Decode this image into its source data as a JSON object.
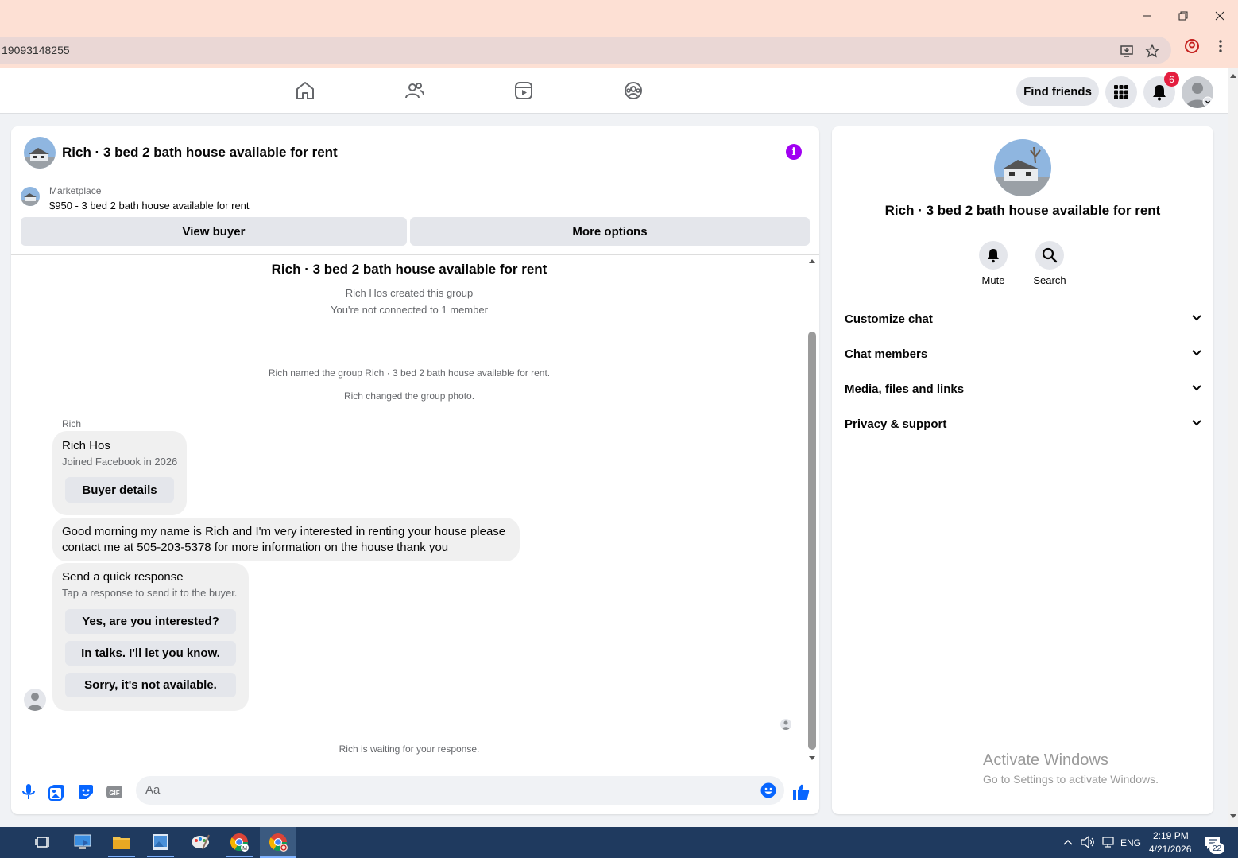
{
  "browser": {
    "address": "19093148255",
    "window_controls": [
      "minimize-icon",
      "restore-icon",
      "close-icon"
    ]
  },
  "nav": {
    "find_friends": "Find friends",
    "notification_count": "6",
    "icons": [
      "home-icon",
      "friends-icon",
      "watch-icon",
      "groups-icon"
    ]
  },
  "chat": {
    "header_title": "Rich · 3 bed 2 bath house available for rent",
    "marketplace_label": "Marketplace",
    "listing": "$950 - 3 bed 2 bath house available for rent",
    "view_buyer": "View buyer",
    "more_options": "More options",
    "group_title": "Rich · 3 bed 2 bath house available for rent",
    "created_by": "Rich Hos created this group",
    "not_connected": "You're not connected to 1 member",
    "event_named": "Rich named the group Rich · 3 bed 2 bath house available for rent.",
    "event_photo": "Rich changed the group photo.",
    "sender": "Rich",
    "profile_card": {
      "name": "Rich Hos",
      "joined": "Joined Facebook in 2026",
      "button": "Buyer details"
    },
    "message_line1": "Good morning my name is Rich and I'm very interested in renting your house please",
    "message_line2": "contact me at 505-203-5378 for more information on the house thank you",
    "quick": {
      "title": "Send a quick response",
      "subtitle": "Tap a response to send it to the buyer.",
      "options": [
        "Yes, are you interested?",
        "In talks. I'll let you know.",
        "Sorry, it's not available."
      ]
    },
    "waiting": "Rich is waiting for your response.",
    "input_placeholder": "Aa"
  },
  "info": {
    "title": "Rich · 3 bed 2 bath house available for rent",
    "mute": "Mute",
    "search": "Search",
    "sections": [
      "Customize chat",
      "Chat members",
      "Media, files and links",
      "Privacy & support"
    ]
  },
  "watermark": {
    "line1": "Activate Windows",
    "line2": "Go to Settings to activate Windows."
  },
  "taskbar": {
    "lang": "ENG",
    "time": "2:19 PM",
    "date": "4/21/2026",
    "notif_count": "22"
  },
  "colors": {
    "accent": "#0866ff",
    "info": "#a100f2",
    "badge": "#e41e3f"
  }
}
